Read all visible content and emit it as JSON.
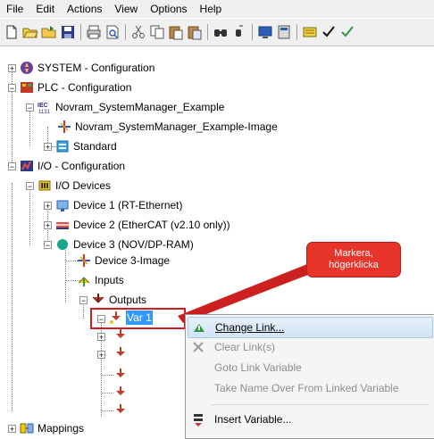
{
  "menu": [
    "File",
    "Edit",
    "Actions",
    "View",
    "Options",
    "Help"
  ],
  "tree": {
    "system": "SYSTEM - Configuration",
    "plc": "PLC - Configuration",
    "iec_badge": "IEC 1131",
    "project": "Novram_SystemManager_Example",
    "project_image": "Novram_SystemManager_Example-Image",
    "standard": "Standard",
    "io": "I/O - Configuration",
    "io_devices": "I/O Devices",
    "device1": "Device 1 (RT-Ethernet)",
    "device2": "Device 2 (EtherCAT (v2.10 only))",
    "device3": "Device 3 (NOV/DP-RAM)",
    "device3_image": "Device 3-Image",
    "inputs": "Inputs",
    "outputs": "Outputs",
    "var1": "Var 1",
    "mappings": "Mappings"
  },
  "callout": {
    "line1": "Markera,",
    "line2": "högerklicka"
  },
  "context_menu": {
    "change_link": "Change Link...",
    "clear_links": "Clear Link(s)",
    "goto_link": "Goto Link Variable",
    "take_name": "Take Name Over From Linked Variable",
    "insert_variable": "Insert Variable..."
  },
  "colors": {
    "selection": "#3399ff",
    "callout": "#e8342a",
    "highlight_border": "#cc1f1f"
  }
}
